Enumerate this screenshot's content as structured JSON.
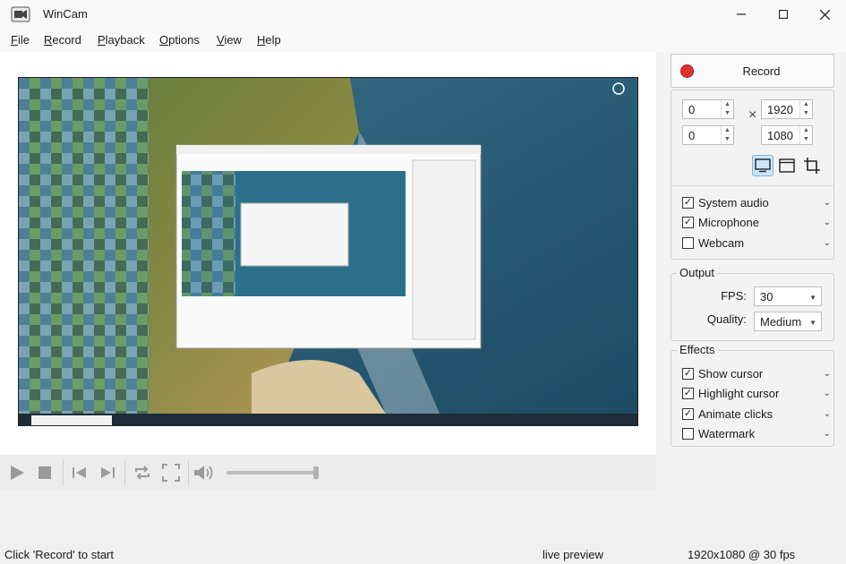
{
  "window": {
    "title": "WinCam"
  },
  "menu": {
    "file": {
      "key": "F",
      "rest": "ile"
    },
    "record": {
      "key": "R",
      "rest": "ecord"
    },
    "playback": {
      "key": "P",
      "rest": "layback"
    },
    "options": {
      "key": "O",
      "rest": "ptions"
    },
    "view": {
      "key": "V",
      "rest": "iew"
    },
    "help": {
      "key": "H",
      "rest": "elp"
    }
  },
  "sidebar": {
    "record_label": "Record",
    "region": {
      "x": "0",
      "y": "0",
      "width": "1920",
      "height": "1080",
      "times": "×"
    },
    "sources": [
      {
        "label": "System audio",
        "checked": true
      },
      {
        "label": "Microphone",
        "checked": true
      },
      {
        "label": "Webcam",
        "checked": false
      }
    ],
    "output": {
      "legend": "Output",
      "fps_label": "FPS:",
      "fps_value": "30",
      "quality_label": "Quality:",
      "quality_value": "Medium"
    },
    "effects": {
      "legend": "Effects",
      "items": [
        {
          "label": "Show cursor",
          "checked": true
        },
        {
          "label": "Highlight cursor",
          "checked": true
        },
        {
          "label": "Animate clicks",
          "checked": true
        },
        {
          "label": "Watermark",
          "checked": false
        }
      ]
    }
  },
  "status": {
    "left": "Click 'Record' to start",
    "mid": "live preview",
    "right": "1920x1080 @ 30 fps"
  },
  "playback": {
    "volume_level": 0.98
  },
  "colors": {
    "record": "#e03131",
    "accent": "#0078d4"
  }
}
